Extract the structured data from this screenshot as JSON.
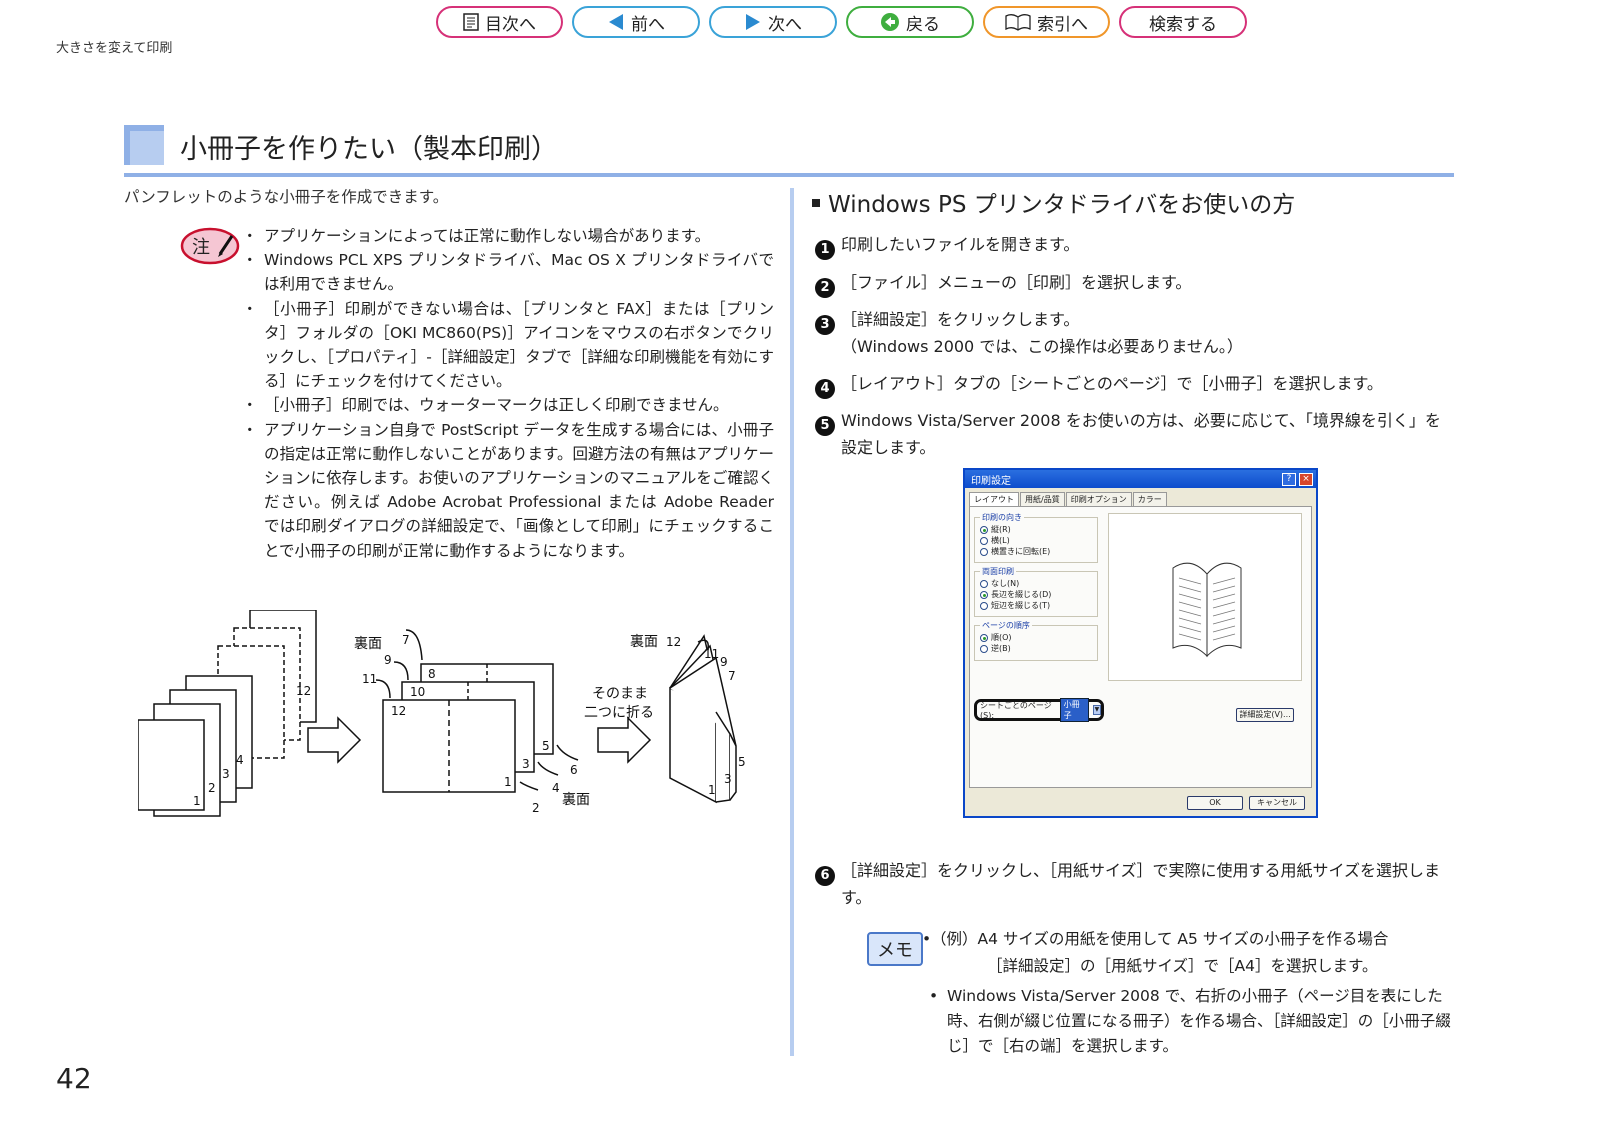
{
  "nav": {
    "toc": "目次へ",
    "prev": "前へ",
    "next": "次へ",
    "back": "戻る",
    "index": "索引へ",
    "search": "検索する"
  },
  "breadcrumb": "大きさを変えて印刷",
  "section": {
    "title": "小冊子を作りたい（製本印刷）",
    "intro": "パンフレットのような小冊子を作成できます。"
  },
  "note_label": "注",
  "notes": [
    "アプリケーションによっては正常に動作しない場合があります。",
    "Windows PCL XPS プリンタドライバ、Mac OS X プリンタドライバでは利用できません。",
    "［小冊子］印刷ができない場合は、［プリンタと FAX］または［プリンタ］フォルダの［OKI MC860(PS)］アイコンをマウスの右ボタンでクリックし、［プロパティ］-［詳細設定］タブで［詳細な印刷機能を有効にする］にチェックを付けてください。",
    "［小冊子］印刷では、ウォーターマークは正しく印刷できません。",
    "アプリケーション自身で PostScript データを生成する場合には、小冊子の指定は正常に動作しないことがあります。回避方法の有無はアプリケーションに依存します。お使いのアプリケーションのマニュアルをご確認ください。例えば Adobe Acrobat Professional または Adobe Reader では印刷ダイアログの詳細設定で、「画像として印刷」にチェックすることで小冊子の印刷が正常に動作するようになります。"
  ],
  "diagram": {
    "stack_numbers": [
      "1",
      "2",
      "3",
      "4",
      "12"
    ],
    "mid_top_labels": [
      "裏面",
      "7",
      "9",
      "8",
      "11",
      "10",
      "12"
    ],
    "mid_bottom_labels": [
      "5",
      "3",
      "6",
      "1",
      "4",
      "2",
      "裏面"
    ],
    "fold_caption_line1": "そのまま",
    "fold_caption_line2": "二つに折る",
    "booklet_labels": [
      "裏面",
      "12",
      "11",
      "9",
      "7",
      "5",
      "3",
      "1"
    ]
  },
  "right": {
    "heading": "Windows PS プリンタドライバをお使いの方",
    "steps": [
      {
        "num": "1",
        "text": "印刷したいファイルを開きます。"
      },
      {
        "num": "2",
        "text": "［ファイル］メニューの［印刷］を選択します。"
      },
      {
        "num": "3",
        "text": "［詳細設定］をクリックします。",
        "sub": "（Windows 2000 では、この操作は必要ありません。）"
      },
      {
        "num": "4",
        "text": "［レイアウト］タブの［シートごとのページ］で［小冊子］を選択します。"
      },
      {
        "num": "5",
        "text": "Windows Vista/Server 2008 をお使いの方は、必要に応じて、「境界線を引く」を設定します。"
      },
      {
        "num": "6",
        "text": "［詳細設定］をクリックし、［用紙サイズ］で実際に使用する用紙サイズを選択します。"
      }
    ]
  },
  "dialog": {
    "title": "印刷設定",
    "help": "?",
    "close": "×",
    "tabs": [
      "レイアウト",
      "用紙/品質",
      "印刷オプション",
      "カラー"
    ],
    "orientation_title": "印刷の向き",
    "orientation": [
      "縦(R)",
      "横(L)",
      "横置きに回転(E)"
    ],
    "duplex_title": "両面印刷",
    "duplex": [
      "なし(N)",
      "長辺を綴じる(D)",
      "短辺を綴じる(T)"
    ],
    "order_title": "ページの順序",
    "order": [
      "順(O)",
      "逆(B)"
    ],
    "pps_label": "シートごとのページ(S):",
    "pps_value": "小冊子",
    "advanced": "詳細設定(V)...",
    "ok": "OK",
    "cancel": "キャンセル"
  },
  "memo": {
    "label": "メモ",
    "item1_line1": "（例）A4 サイズの用紙を使用して A5 サイズの小冊子を作る場合",
    "item1_line2": "［詳細設定］の［用紙サイズ］で［A4］を選択します。",
    "item2": "Windows Vista/Server 2008 で、右折の小冊子（ページ目を表にした時、右側が綴じ位置になる冊子）を作る場合、［詳細設定］の［小冊子綴じ］で［右の端］を選択します。"
  },
  "page_number": "42"
}
